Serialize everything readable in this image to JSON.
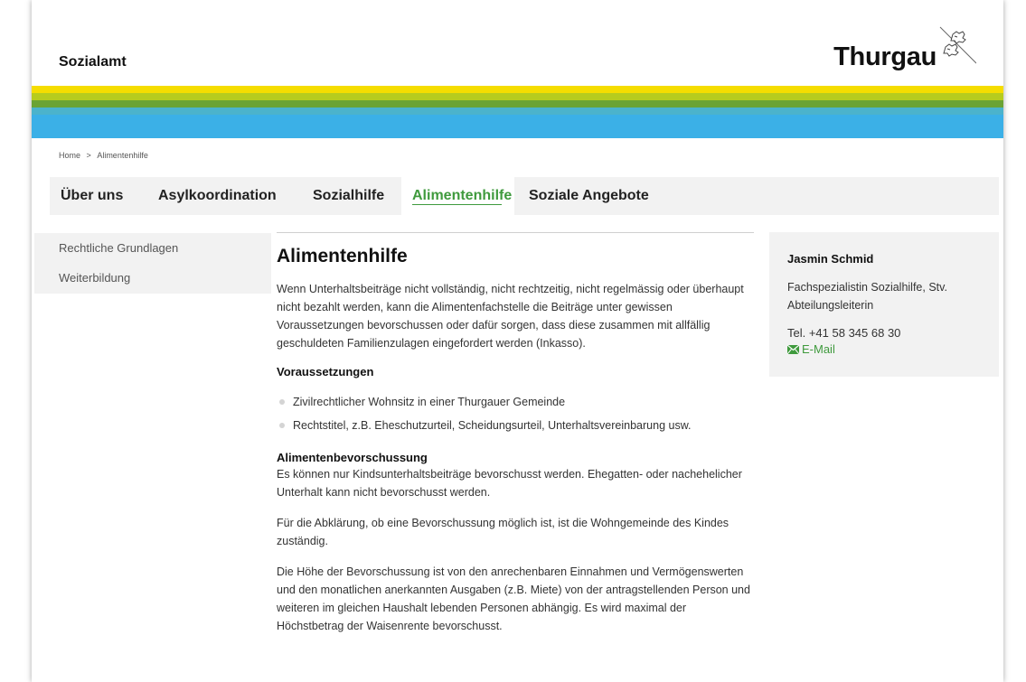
{
  "header": {
    "site_title": "Sozialamt",
    "logo_text": "Thurgau"
  },
  "colors": {
    "stripe_yellow": "#f5dd00",
    "stripe_lime": "#b6cc1e",
    "stripe_green": "#6aa334",
    "stripe_teal": "#4bb3cc",
    "stripe_blue": "#3bb0e7",
    "accent_green": "#3f9a3d",
    "panel_gray": "#f2f2f2"
  },
  "breadcrumb": {
    "home": "Home",
    "separator": ">",
    "current": "Alimentenhilfe"
  },
  "nav": {
    "items": [
      {
        "label": "Über uns"
      },
      {
        "label": "Asylkoordination"
      },
      {
        "label": "Sozialhilfe"
      },
      {
        "label": "Alimentenhilfe"
      },
      {
        "label": "Soziale Angebote"
      }
    ]
  },
  "sidebar": {
    "items": [
      {
        "label": "Rechtliche Grundlagen"
      },
      {
        "label": "Weiterbildung"
      }
    ]
  },
  "main": {
    "title": "Alimentenhilfe",
    "intro": "Wenn Unterhaltsbeiträge nicht vollständig, nicht rechtzeitig, nicht regelmässig oder überhaupt nicht bezahlt werden, kann die Alimentenfachstelle die Beiträge unter gewissen Voraussetzungen bevorschussen oder dafür sorgen, dass diese zusammen mit allfällig geschuldeten Familienzulagen eingefordert werden (Inkasso).",
    "section1_title": "Voraussetzungen",
    "bullets": [
      {
        "text": "Zivilrechtlicher Wohnsitz in einer Thurgauer Gemeinde"
      },
      {
        "text": "Rechtstitel, z.B. Eheschutzurteil, Scheidungsurteil, Unterhaltsvereinbarung usw."
      }
    ],
    "section2_title": "Alimentenbevorschussung",
    "section2_p1": "Es können nur Kindsunterhaltsbeiträge bevorschusst werden. Ehegatten- oder nachehelicher Unterhalt kann nicht bevorschusst werden.",
    "section2_p2": "Für die Abklärung, ob eine Bevorschussung möglich ist, ist die Wohngemeinde des Kindes zuständig.",
    "section2_p3": "Die Höhe der Bevorschussung ist von den anrechenbaren Einnahmen und Vermögenswerten und den monatlichen anerkannten Ausgaben (z.B. Miete) von der antragstellenden Person und weiteren im gleichen Haushalt lebenden Personen abhängig. Es wird maximal der Höchstbetrag der Waisenrente bevorschusst."
  },
  "contact": {
    "name": "Jasmin Schmid",
    "role": "Fachspezialistin Sozialhilfe, Stv. Abteilungsleiterin",
    "tel": "Tel. +41 58 345 68 30",
    "mail_label": "E-Mail",
    "mail_icon": "envelope-icon"
  }
}
